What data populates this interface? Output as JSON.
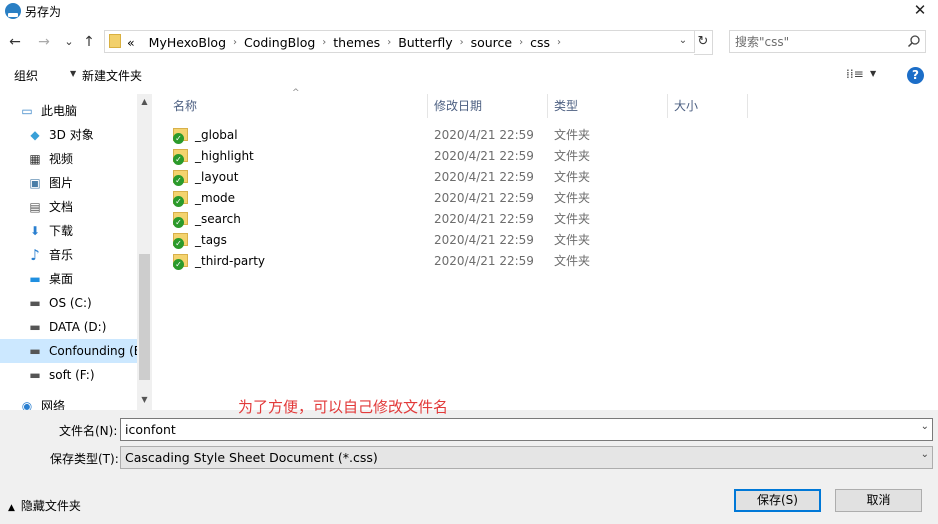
{
  "window": {
    "title": "另存为",
    "close": "✕"
  },
  "nav": {
    "back": "←",
    "forward": "→",
    "recent": "⌄",
    "up": "↑",
    "breadcrumb": [
      "«",
      "MyHexoBlog",
      "CodingBlog",
      "themes",
      "Butterfly",
      "source",
      "css"
    ],
    "refresh": "↻",
    "search_placeholder": "搜索\"css\""
  },
  "toolbar": {
    "organize": "组织",
    "new_folder": "新建文件夹",
    "view": "⁞⁞≡",
    "help": "?"
  },
  "sidebar": {
    "items": [
      {
        "label": "此电脑",
        "icon": "computer-icon",
        "glyph": "▭"
      },
      {
        "label": "3D 对象",
        "icon": "3d-objects-icon",
        "glyph": "◆"
      },
      {
        "label": "视频",
        "icon": "video-icon",
        "glyph": "▦"
      },
      {
        "label": "图片",
        "icon": "pictures-icon",
        "glyph": "▣"
      },
      {
        "label": "文档",
        "icon": "documents-icon",
        "glyph": "▤"
      },
      {
        "label": "下载",
        "icon": "downloads-icon",
        "glyph": "⬇"
      },
      {
        "label": "音乐",
        "icon": "music-icon",
        "glyph": "♪"
      },
      {
        "label": "桌面",
        "icon": "desktop-icon",
        "glyph": "▬"
      },
      {
        "label": "OS (C:)",
        "icon": "drive-icon",
        "glyph": "▬"
      },
      {
        "label": "DATA (D:)",
        "icon": "drive-icon",
        "glyph": "▬"
      },
      {
        "label": "Confounding (E",
        "icon": "drive-icon",
        "glyph": "▬"
      },
      {
        "label": "soft (F:)",
        "icon": "drive-icon",
        "glyph": "▬"
      },
      {
        "label": "网络",
        "icon": "network-icon",
        "glyph": "◉"
      }
    ]
  },
  "columns": {
    "name": "名称",
    "modified": "修改日期",
    "type": "类型",
    "size": "大小"
  },
  "files": [
    {
      "name": "_global",
      "modified": "2020/4/21 22:59",
      "type": "文件夹"
    },
    {
      "name": "_highlight",
      "modified": "2020/4/21 22:59",
      "type": "文件夹"
    },
    {
      "name": "_layout",
      "modified": "2020/4/21 22:59",
      "type": "文件夹"
    },
    {
      "name": "_mode",
      "modified": "2020/4/21 22:59",
      "type": "文件夹"
    },
    {
      "name": "_search",
      "modified": "2020/4/21 22:59",
      "type": "文件夹"
    },
    {
      "name": "_tags",
      "modified": "2020/4/21 22:59",
      "type": "文件夹"
    },
    {
      "name": "_third-party",
      "modified": "2020/4/21 22:59",
      "type": "文件夹"
    }
  ],
  "annotation": "为了方便，可以自己修改文件名",
  "form": {
    "filename_label": "文件名(N):",
    "filename_value": "iconfont",
    "filetype_label": "保存类型(T):",
    "filetype_value": "Cascading Style Sheet Document (*.css)"
  },
  "footer": {
    "hide_folders": "隐藏文件夹",
    "save": "保存(S)",
    "cancel": "取消"
  },
  "colors": {
    "accent": "#0078d7",
    "annotation": "#e23a3a",
    "selected": "#cce8ff"
  }
}
